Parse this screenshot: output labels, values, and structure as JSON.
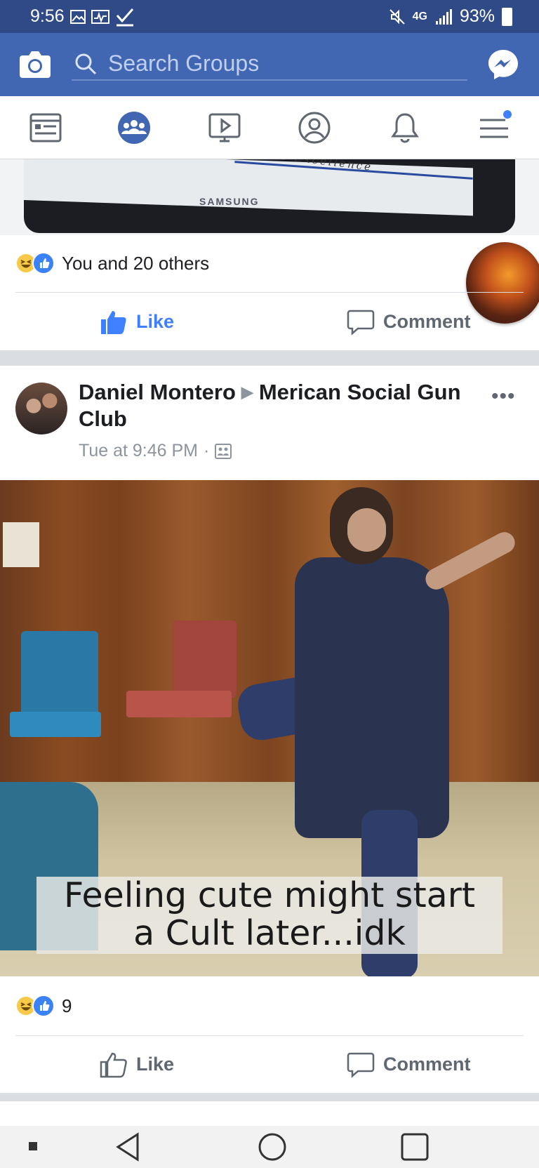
{
  "status_bar": {
    "time": "9:56",
    "network": "4G",
    "battery": "93%"
  },
  "header": {
    "search_placeholder": "Search Groups"
  },
  "tabs": [
    "news-feed",
    "groups",
    "watch",
    "profile",
    "notifications",
    "menu"
  ],
  "colors": {
    "brand": "#4267b2",
    "status_bar": "#2f4a86",
    "like_blue": "#4080ff",
    "text_gray": "#8d949e"
  },
  "post1": {
    "reaction_summary": "You and 20 others",
    "like_label": "Like",
    "comment_label": "Comment",
    "photo_text": "Service Excellence",
    "photo_brand": "SAMSUNG"
  },
  "post2": {
    "author": "Daniel Montero",
    "group": "Merican Social Gun Club",
    "timestamp": "Tue at 9:46 PM",
    "image_caption_line1": "Feeling cute might start",
    "image_caption_line2": "a Cult later...idk",
    "reaction_count": "9",
    "like_label": "Like",
    "comment_label": "Comment"
  }
}
